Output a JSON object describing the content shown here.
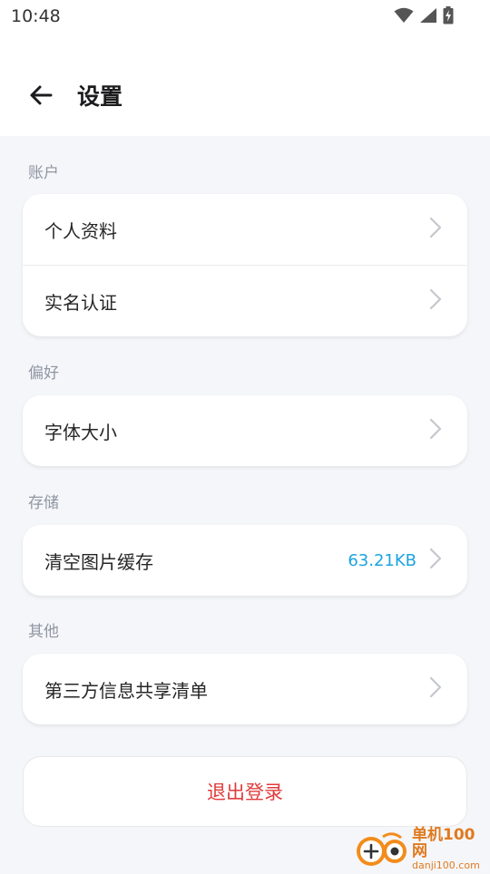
{
  "status_bar": {
    "time": "10:48",
    "icons": [
      "wifi-icon",
      "signal-icon",
      "battery-charging-icon"
    ]
  },
  "header": {
    "back_icon": "arrow-left-icon",
    "title": "设置"
  },
  "sections": {
    "account": {
      "label": "账户",
      "items": [
        {
          "label": "个人资料"
        },
        {
          "label": "实名认证"
        }
      ]
    },
    "preferences": {
      "label": "偏好",
      "items": [
        {
          "label": "字体大小"
        }
      ]
    },
    "storage": {
      "label": "存储",
      "items": [
        {
          "label": "清空图片缓存",
          "value": "63.21KB"
        }
      ]
    },
    "other": {
      "label": "其他",
      "items": [
        {
          "label": "第三方信息共享清单"
        }
      ]
    }
  },
  "logout": {
    "label": "退出登录"
  },
  "watermark": {
    "name": "单机100网",
    "url": "danji100.com"
  },
  "colors": {
    "accent_value": "#1ca3e0",
    "logout_text": "#e03b3b",
    "page_background": "#f5f6f9",
    "section_label": "#8f96a3"
  }
}
